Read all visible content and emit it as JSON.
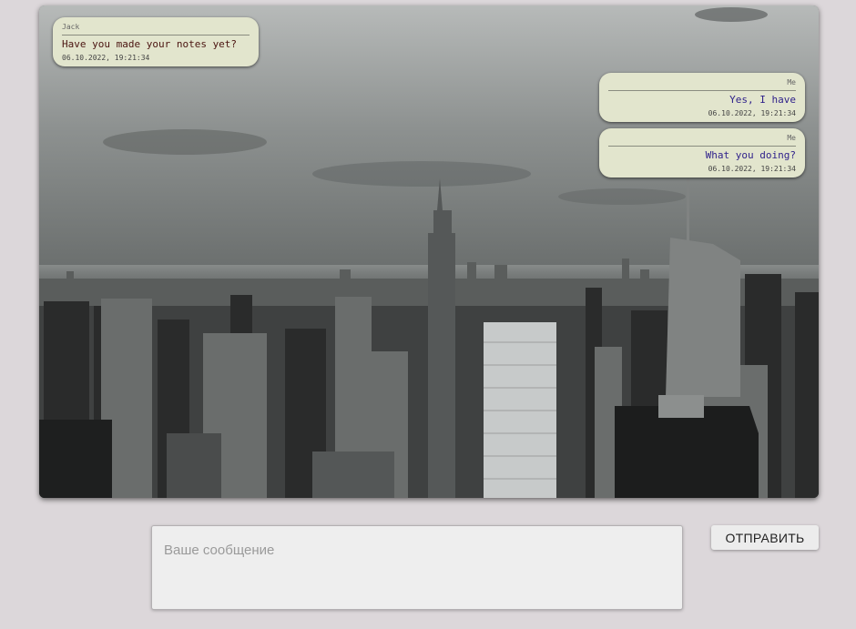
{
  "chat": {
    "background_image": "city-skyline-photo",
    "messages": [
      {
        "author": "Jack",
        "text": "Have you made your notes yet?",
        "time": "06.10.2022, 19:21:34",
        "side": "incoming"
      },
      {
        "author": "Me",
        "text": "Yes, I have",
        "time": "06.10.2022, 19:21:34",
        "side": "outgoing"
      },
      {
        "author": "Me",
        "text": "What you doing?",
        "time": "06.10.2022, 19:21:34",
        "side": "outgoing"
      }
    ]
  },
  "composer": {
    "placeholder": "Ваше сообщение",
    "value": ""
  },
  "send_button": {
    "label": "ОТПРАВИТЬ"
  },
  "colors": {
    "page_background": "#dcd7da",
    "bubble_background": "#e2e5cd",
    "incoming_text": "#4a1410",
    "outgoing_text": "#2d1f8a"
  }
}
